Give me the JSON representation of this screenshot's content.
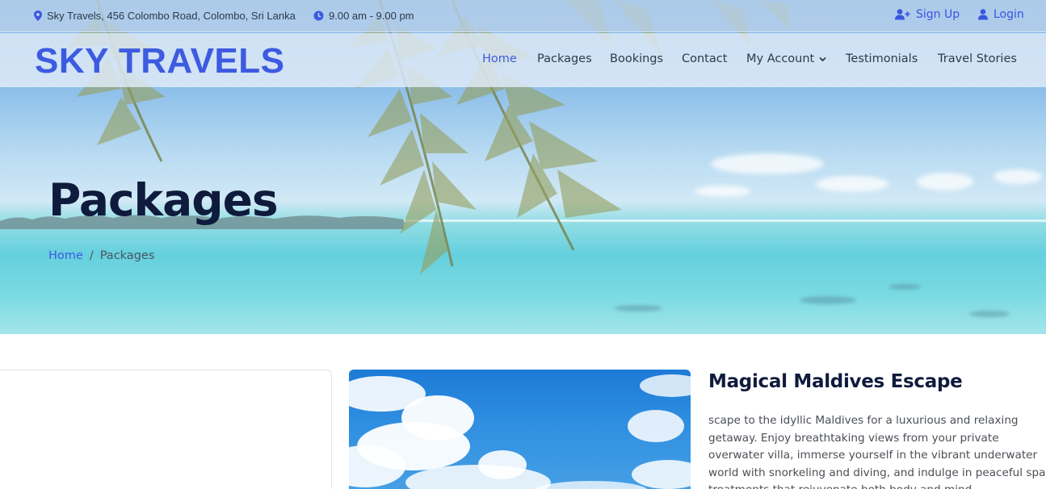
{
  "topbar": {
    "address": "Sky Travels, 456 Colombo Road, Colombo, Sri Lanka",
    "hours": "9.00 am - 9.00 pm",
    "signup_label": "Sign Up",
    "login_label": "Login"
  },
  "brand": "SKY TRAVELS",
  "nav": {
    "items": [
      "Home",
      "Packages",
      "Bookings",
      "Contact",
      "My Account",
      "Testimonials",
      "Travel Stories"
    ],
    "active": "Home"
  },
  "hero": {
    "title": "Packages",
    "breadcrumb": {
      "home": "Home",
      "separator": "/",
      "current": "Packages"
    }
  },
  "package": {
    "title": "Magical Maldives Escape",
    "description": "scape to the idyllic Maldives for a luxurious and relaxing getaway. Enjoy breathtaking views from your private overwater villa, immerse yourself in the vibrant underwater world with snorkeling and diving, and indulge in peaceful spa treatments that rejuvenate both body and mind."
  },
  "colors": {
    "accent": "#3d5be0",
    "heading": "#0f1b3d",
    "body_text": "#4a4f56"
  },
  "icons": {
    "address": "map-pin-icon",
    "hours": "clock-icon",
    "signup": "user-plus-icon",
    "login": "user-icon",
    "dropdown": "chevron-down-icon"
  }
}
